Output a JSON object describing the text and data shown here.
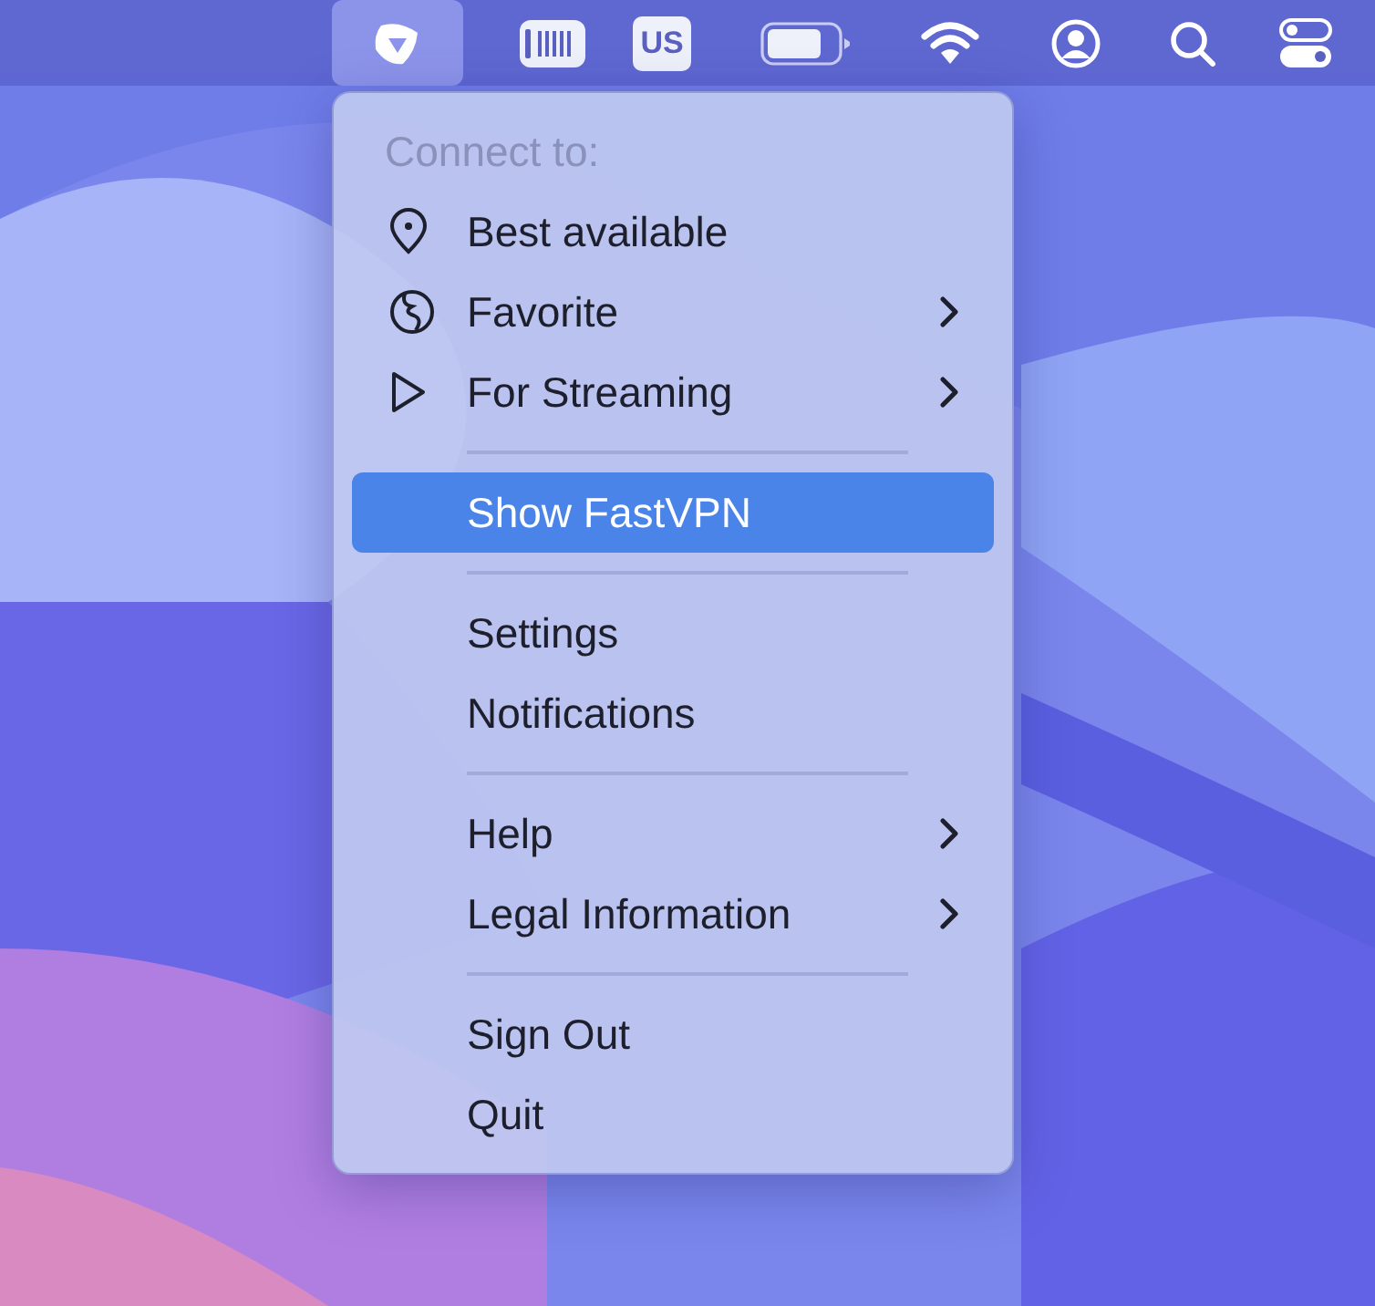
{
  "menu_bar": {
    "items": [
      {
        "kind": "logo",
        "selected": true
      },
      {
        "kind": "meter",
        "selected": false
      },
      {
        "kind": "input",
        "label": "US",
        "selected": false
      },
      {
        "kind": "battery",
        "selected": false
      },
      {
        "kind": "wifi",
        "selected": false
      },
      {
        "kind": "user",
        "selected": false
      },
      {
        "kind": "search",
        "selected": false
      },
      {
        "kind": "controls",
        "selected": false
      }
    ]
  },
  "menu": {
    "header": "Connect to:",
    "sections": [
      [
        {
          "label": "Best available",
          "kind": "pin",
          "submenu": false,
          "selected": false
        },
        {
          "label": "Favorite",
          "kind": "globe",
          "submenu": true,
          "selected": false
        },
        {
          "label": "For Streaming",
          "kind": "play",
          "submenu": true,
          "selected": false
        }
      ],
      [
        {
          "label": "Show FastVPN",
          "submenu": false,
          "selected": true
        }
      ],
      [
        {
          "label": "Settings",
          "submenu": false,
          "selected": false
        },
        {
          "label": "Notifications",
          "submenu": false,
          "selected": false
        }
      ],
      [
        {
          "label": "Help",
          "submenu": true,
          "selected": false
        },
        {
          "label": "Legal Information",
          "submenu": true,
          "selected": false
        }
      ],
      [
        {
          "label": "Sign Out",
          "submenu": false,
          "selected": false
        },
        {
          "label": "Quit",
          "submenu": false,
          "selected": false
        }
      ]
    ]
  }
}
